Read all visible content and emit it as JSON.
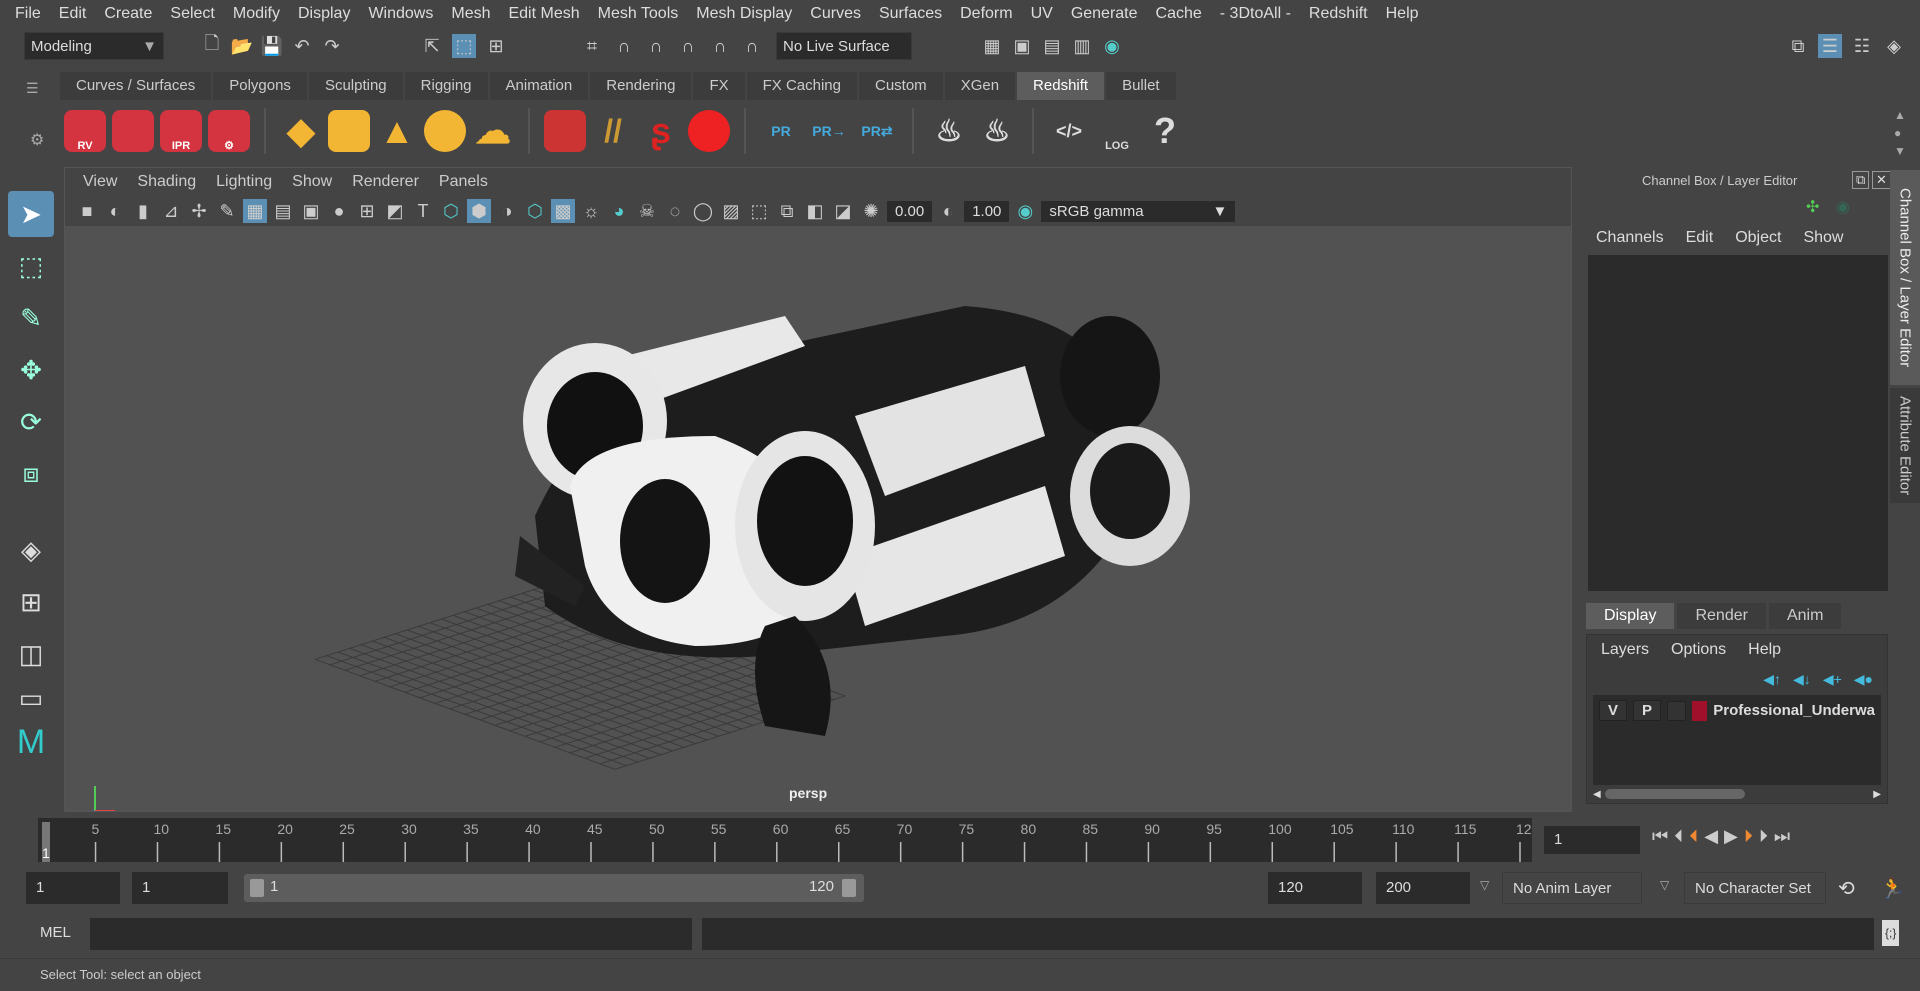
{
  "menubar": [
    "File",
    "Edit",
    "Create",
    "Select",
    "Modify",
    "Display",
    "Windows",
    "Mesh",
    "Edit Mesh",
    "Mesh Tools",
    "Mesh Display",
    "Curves",
    "Surfaces",
    "Deform",
    "UV",
    "Generate",
    "Cache",
    "- 3DtoAll -",
    "Redshift",
    "Help"
  ],
  "toolbar": {
    "mode": "Modeling",
    "live_surface": "No Live Surface"
  },
  "shelf_tabs": [
    "Curves / Surfaces",
    "Polygons",
    "Sculpting",
    "Rigging",
    "Animation",
    "Rendering",
    "FX",
    "FX Caching",
    "Custom",
    "XGen",
    "Redshift",
    "Bullet"
  ],
  "active_shelf": "Redshift",
  "shelf_labels": {
    "rv": "RV",
    "ipr": "IPR",
    "pr": "PR",
    "log": "LOG",
    "help": "?"
  },
  "viewport": {
    "menu": [
      "View",
      "Shading",
      "Lighting",
      "Show",
      "Renderer",
      "Panels"
    ],
    "exposure": "0.00",
    "gamma": "1.00",
    "colorspace": "sRGB gamma",
    "camera": "persp"
  },
  "right_panel": {
    "title": "Channel Box / Layer Editor",
    "menu": [
      "Channels",
      "Edit",
      "Object",
      "Show"
    ],
    "tabs": [
      "Display",
      "Render",
      "Anim"
    ],
    "layer_menu": [
      "Layers",
      "Options",
      "Help"
    ],
    "layer": {
      "v": "V",
      "p": "P",
      "name": "Professional_Underwa",
      "color": "#a0102a"
    }
  },
  "side_tabs": [
    "Channel Box / Layer Editor",
    "Attribute Editor"
  ],
  "timeline": {
    "ticks": [
      "5",
      "10",
      "15",
      "20",
      "25",
      "30",
      "35",
      "40",
      "45",
      "50",
      "55",
      "60",
      "65",
      "70",
      "75",
      "80",
      "85",
      "90",
      "95",
      "100",
      "105",
      "110",
      "115",
      "12"
    ],
    "current": "1",
    "current_field": "1"
  },
  "range": {
    "start": "1",
    "playback_start": "1",
    "slider_start": "1",
    "slider_end": "120",
    "playback_end": "120",
    "end": "200",
    "anim_layer": "No Anim Layer",
    "character_set": "No Character Set"
  },
  "command": {
    "label": "MEL"
  },
  "status": "Select Tool: select an object"
}
